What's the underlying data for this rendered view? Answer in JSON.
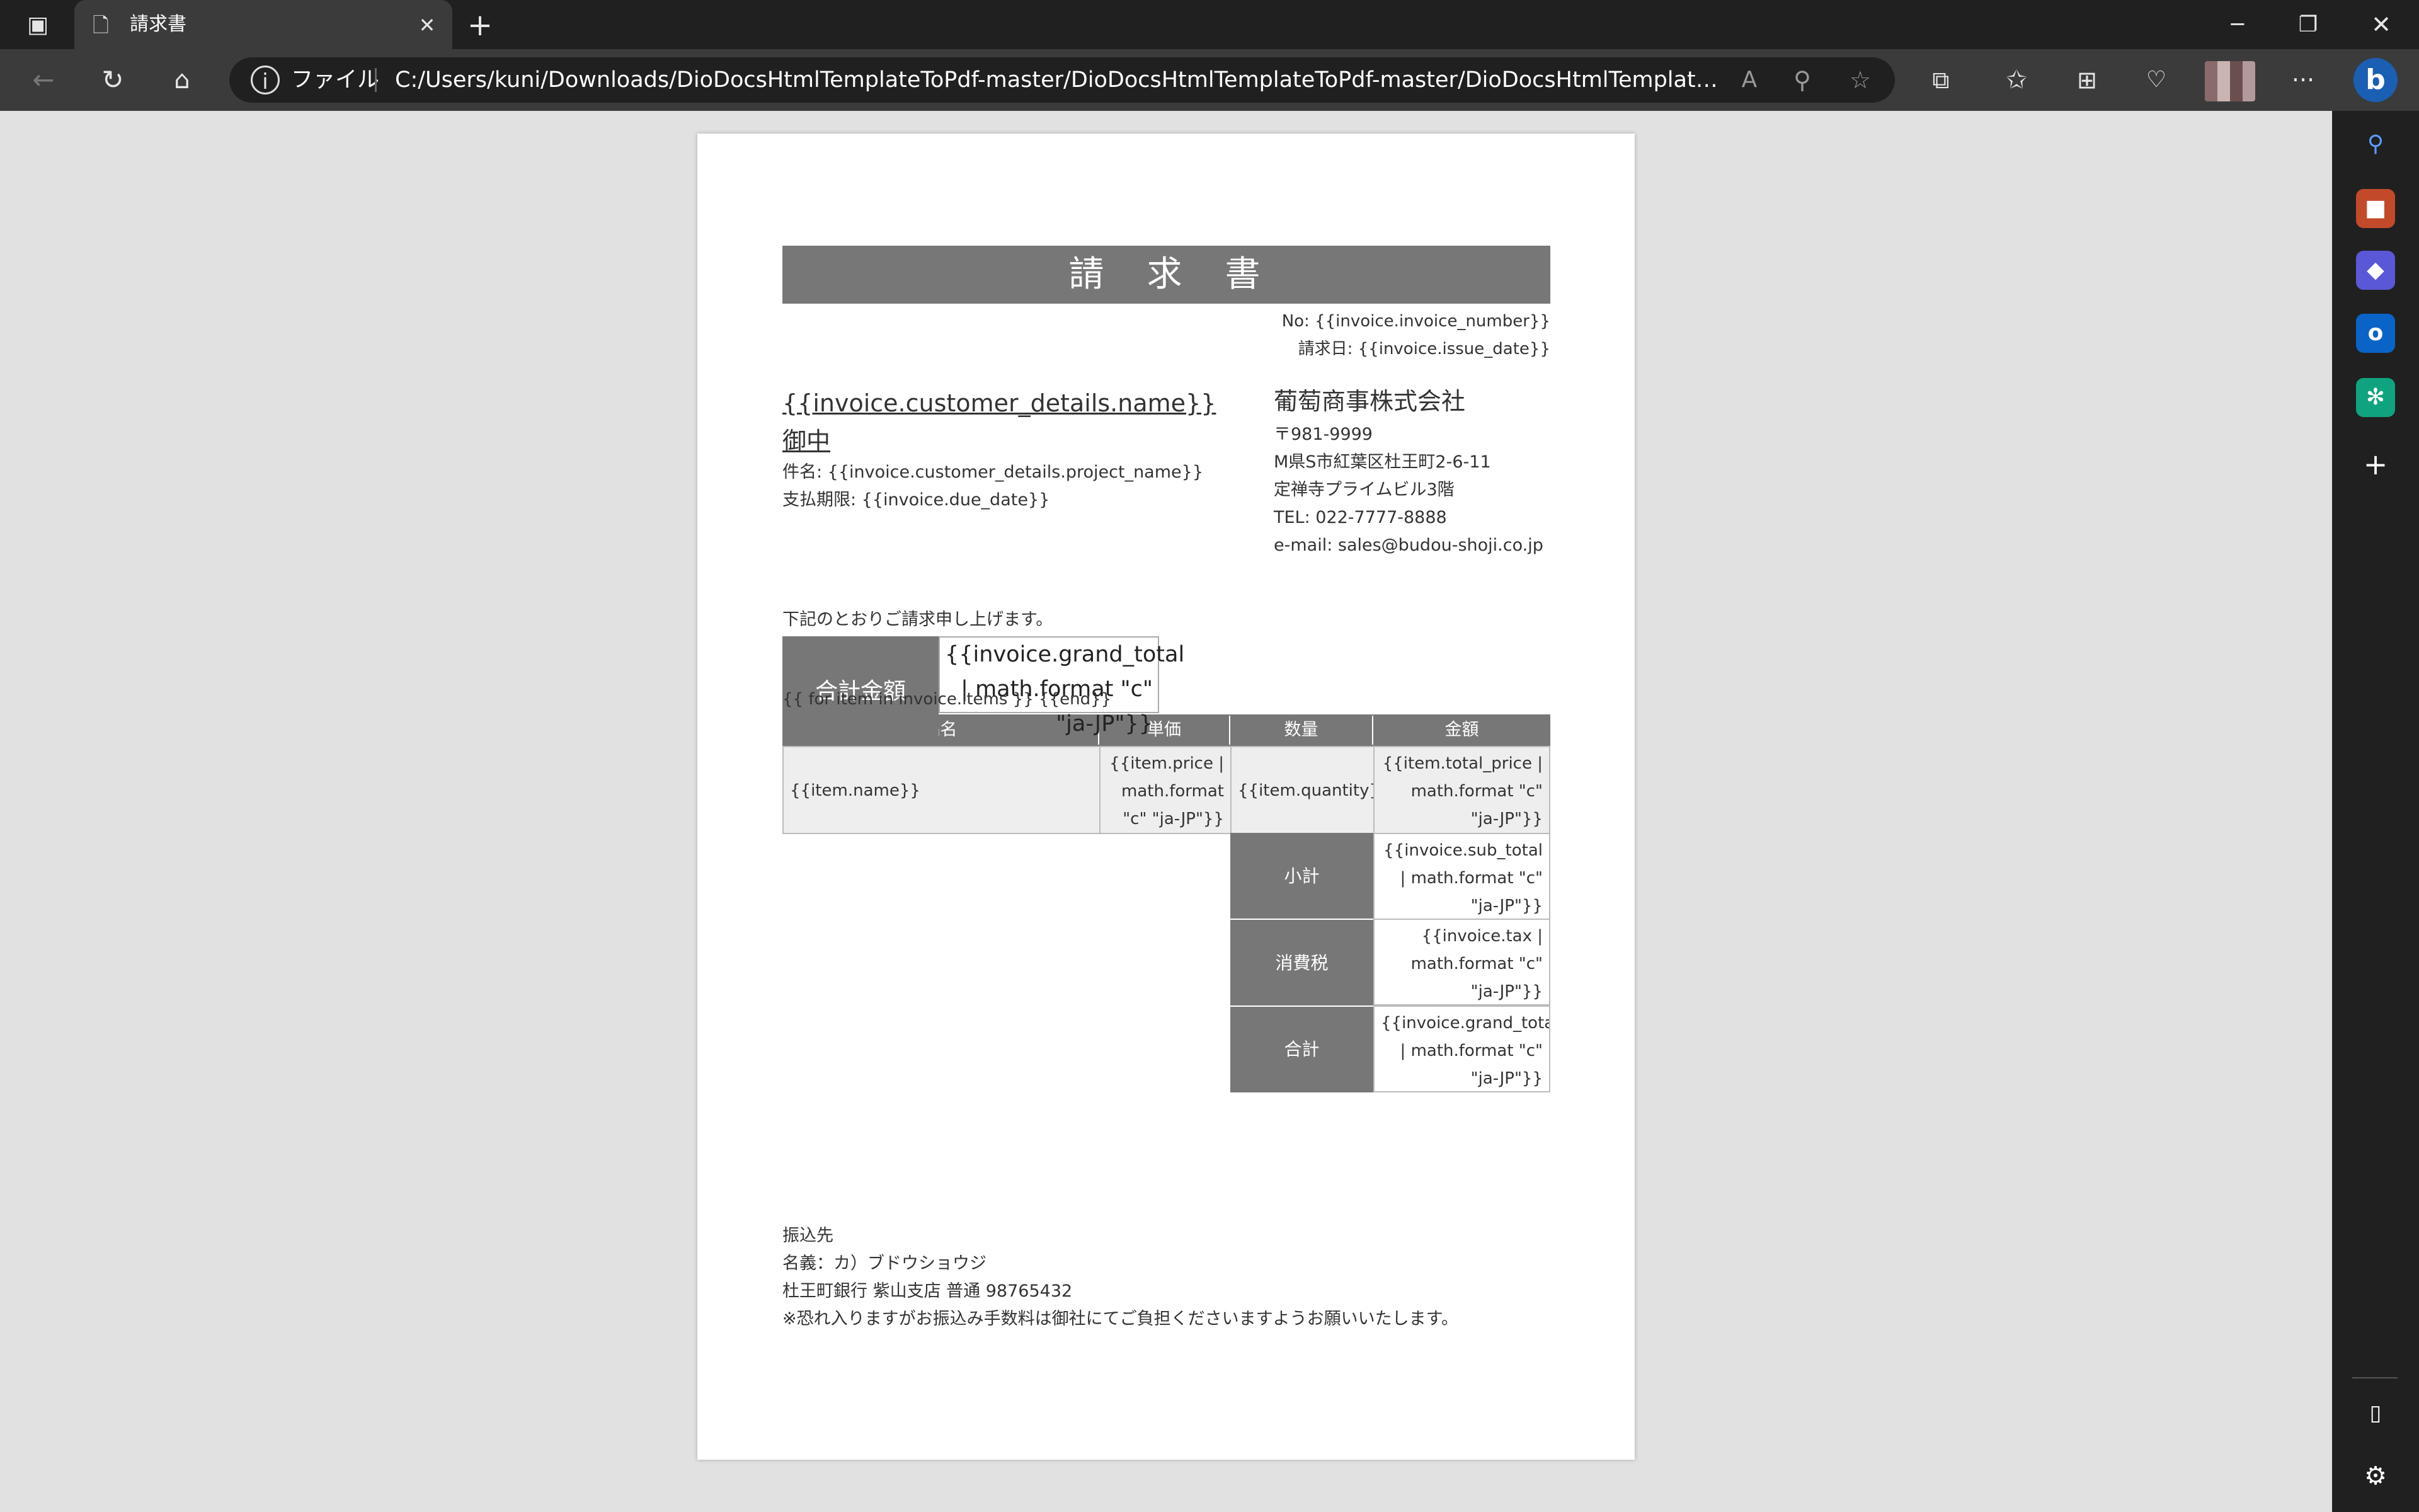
{
  "browser": {
    "tab_title": "請求書",
    "address_label": "ファイル",
    "url": "C:/Users/kuni/Downloads/DioDocsHtmlTemplateToPdf-master/DioDocsHtmlTemplateToPdf-master/DioDocsHtmlTemplateToPdf/Templ...",
    "new_tab_glyph": "+",
    "read_aloud_label": "A",
    "more_glyph": "···"
  },
  "invoice": {
    "title": "請　求　書",
    "number_line": "No: {{invoice.invoice_number}}",
    "issue_date_line": "請求日: {{invoice.issue_date}}",
    "customer_line": "{{invoice.customer_details.name}} 御中",
    "project_line": "件名: {{invoice.customer_details.project_name}}",
    "due_line": "支払期限: {{invoice.due_date}}",
    "company": {
      "name": "葡萄商事株式会社",
      "postal": "〒981-9999",
      "address1": "M県S市紅葉区杜王町2-6-11",
      "address2": "定禅寺プライムビル3階",
      "tel": "TEL: 022-7777-8888",
      "email": "e-mail: sales@budou-shoji.co.jp"
    },
    "intro": "下記のとおりご請求申し上げます。",
    "total_label": "合計金額",
    "total_value": "{{invoice.grand_total | math.format \"c\" \"ja-JP\"}}",
    "loop_text": "{{ for item in invoice.items }} {{end}}",
    "headers": [
      "品名",
      "単価",
      "数量",
      "金額"
    ],
    "row": {
      "name": "{{item.name}}",
      "price": "{{item.price | math.format \"c\" \"ja-JP\"}}",
      "quantity": "{{item.quantity}}",
      "total": "{{item.total_price | math.format \"c\" \"ja-JP\"}}"
    },
    "summary": [
      {
        "label": "小計",
        "value": "{{invoice.sub_total | math.format \"c\" \"ja-JP\"}}"
      },
      {
        "label": "消費税",
        "value": "{{invoice.tax | math.format \"c\" \"ja-JP\"}}"
      },
      {
        "label": "合計",
        "value": "{{invoice.grand_total | math.format \"c\" \"ja-JP\"}}"
      }
    ],
    "bank": {
      "heading": "振込先",
      "holder": "名義：カ）ブドウショウジ",
      "account": "杜王町銀行 紫山支店 普通 98765432",
      "note": "※恐れ入りますがお振込み手数料は御社にてご負担くださいますようお願いいたします。"
    }
  }
}
